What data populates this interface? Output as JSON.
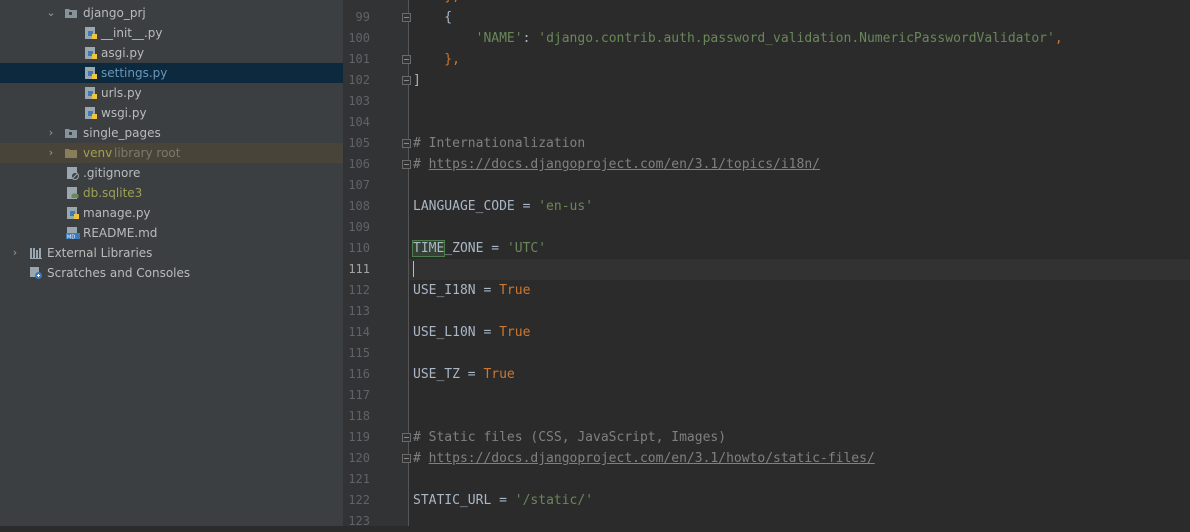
{
  "project_tree": {
    "items": [
      {
        "label": "django_prj",
        "type": "folder",
        "expanded": true
      },
      {
        "label": "__init__.py",
        "type": "python-file"
      },
      {
        "label": "asgi.py",
        "type": "python-file"
      },
      {
        "label": "settings.py",
        "type": "python-file",
        "selected": true
      },
      {
        "label": "urls.py",
        "type": "python-file"
      },
      {
        "label": "wsgi.py",
        "type": "python-file"
      },
      {
        "label": "single_pages",
        "type": "folder",
        "expanded": false
      },
      {
        "label": "venv",
        "suffix": "library root",
        "type": "excluded-folder",
        "expanded": false
      },
      {
        "label": ".gitignore",
        "type": "gitignore-file"
      },
      {
        "label": "db.sqlite3",
        "type": "database-file"
      },
      {
        "label": "manage.py",
        "type": "python-file"
      },
      {
        "label": "README.md",
        "type": "markdown-file"
      },
      {
        "label": "External Libraries",
        "type": "libraries",
        "expanded": false
      },
      {
        "label": "Scratches and Consoles",
        "type": "scratches"
      }
    ]
  },
  "editor": {
    "current_line": "111",
    "lines": [
      {
        "num": "99",
        "text": "    {"
      },
      {
        "num": "100",
        "key": "'NAME'",
        "sep": ": ",
        "value": "'django.contrib.auth.password_validation.NumericPasswordValidator'",
        "end": ","
      },
      {
        "num": "101",
        "text": "    },"
      },
      {
        "num": "102",
        "text": "]"
      },
      {
        "num": "103",
        "text": ""
      },
      {
        "num": "104",
        "text": ""
      },
      {
        "num": "105",
        "text": "# Internationalization"
      },
      {
        "num": "106",
        "prefix": "# ",
        "link": "https://docs.djangoproject.com/en/3.1/topics/i18n/"
      },
      {
        "num": "107",
        "text": ""
      },
      {
        "num": "108",
        "name": "LANGUAGE_CODE",
        "op": " = ",
        "value": "'en-us'"
      },
      {
        "num": "109",
        "text": ""
      },
      {
        "num": "110",
        "highlight": "TIME",
        "name": "_ZONE",
        "op": " = ",
        "value": "'UTC'"
      },
      {
        "num": "111",
        "text": ""
      },
      {
        "num": "112",
        "name": "USE_I18N",
        "op": " = ",
        "value": "True"
      },
      {
        "num": "113",
        "text": ""
      },
      {
        "num": "114",
        "name": "USE_L10N",
        "op": " = ",
        "value": "True"
      },
      {
        "num": "115",
        "text": ""
      },
      {
        "num": "116",
        "name": "USE_TZ",
        "op": " = ",
        "value": "True"
      },
      {
        "num": "117",
        "text": ""
      },
      {
        "num": "118",
        "text": ""
      },
      {
        "num": "119",
        "text": "# Static files (CSS, JavaScript, Images)"
      },
      {
        "num": "120",
        "prefix": "# ",
        "link": "https://docs.djangoproject.com/en/3.1/howto/static-files/"
      },
      {
        "num": "121",
        "text": ""
      },
      {
        "num": "122",
        "name": "STATIC_URL",
        "op": " = ",
        "value": "'/static/'"
      },
      {
        "num": "123",
        "text": ""
      }
    ]
  },
  "colors": {
    "selection": "#0d293e",
    "excluded_folder": "#49443a",
    "string": "#6a8759",
    "keyword": "#cc7832",
    "comment": "#808080"
  }
}
